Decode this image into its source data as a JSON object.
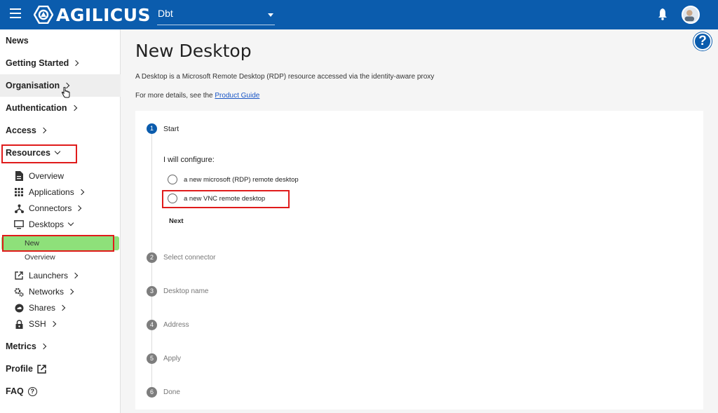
{
  "topbar": {
    "logo_text": "AGILICUS",
    "org_value": "Dbt",
    "brand_color": "#0b5cad"
  },
  "help_icon": "?",
  "sidebar": {
    "items": [
      {
        "label": "News"
      },
      {
        "label": "Getting Started"
      },
      {
        "label": "Organisation"
      },
      {
        "label": "Authentication"
      },
      {
        "label": "Access"
      },
      {
        "label": "Resources"
      }
    ],
    "resources_sub": [
      {
        "label": "Overview",
        "icon": "document-icon"
      },
      {
        "label": "Applications",
        "icon": "grid-icon"
      },
      {
        "label": "Connectors",
        "icon": "connectors-icon"
      },
      {
        "label": "Desktops",
        "icon": "monitor-icon"
      }
    ],
    "desktops_sub": [
      {
        "label": "New"
      },
      {
        "label": "Overview"
      }
    ],
    "resources_sub2": [
      {
        "label": "Launchers",
        "icon": "launch-icon"
      },
      {
        "label": "Networks",
        "icon": "gears-icon"
      },
      {
        "label": "Shares",
        "icon": "cloud-icon"
      },
      {
        "label": "SSH",
        "icon": "lock-icon"
      }
    ],
    "bottom": [
      {
        "label": "Metrics"
      },
      {
        "label": "Profile"
      },
      {
        "label": "FAQ"
      }
    ],
    "highlight_color": "#8ee07a"
  },
  "main": {
    "title": "New Desktop",
    "description": "A Desktop is a Microsoft Remote Desktop (RDP) resource accessed via the identity-aware proxy",
    "details_prefix": "For more details, see the ",
    "details_link": "Product Guide",
    "stepper": {
      "steps": [
        {
          "num": "1",
          "label": "Start"
        },
        {
          "num": "2",
          "label": "Select connector"
        },
        {
          "num": "3",
          "label": "Desktop name"
        },
        {
          "num": "4",
          "label": "Address"
        },
        {
          "num": "5",
          "label": "Apply"
        },
        {
          "num": "6",
          "label": "Done"
        }
      ],
      "configure_label": "I will configure:",
      "options": [
        {
          "label": "a new microsoft (RDP) remote desktop"
        },
        {
          "label": "a new VNC remote desktop"
        }
      ],
      "next_label": "Next"
    }
  },
  "annotation_color": "#e01b1b"
}
